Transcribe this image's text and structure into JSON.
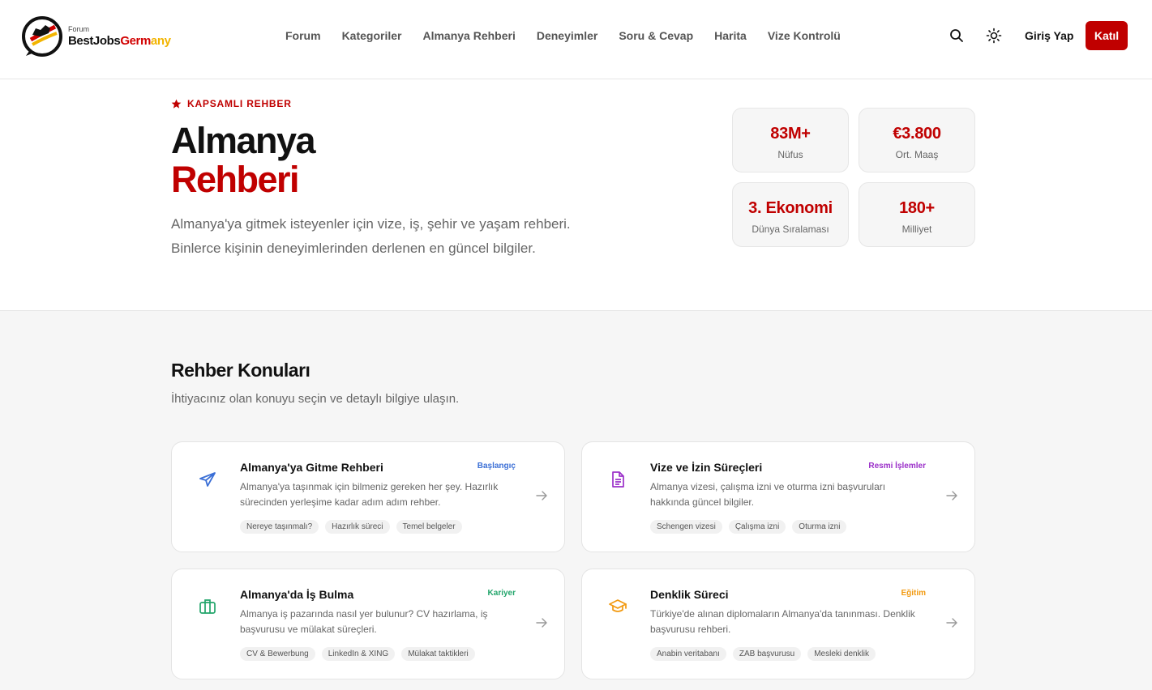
{
  "header": {
    "logo": {
      "small": "Forum",
      "part1": "BestJobs",
      "part2": "Germ",
      "part3": "any"
    },
    "nav": [
      "Forum",
      "Kategoriler",
      "Almanya Rehberi",
      "Deneyimler",
      "Soru & Cevap",
      "Harita",
      "Vize Kontrolü"
    ],
    "login_label": "Giriş Yap",
    "join_label": "Katıl"
  },
  "hero": {
    "eyebrow": "KAPSAMLI REHBER",
    "title_line1": "Almanya",
    "title_line2": "Rehberi",
    "desc_line1": "Almanya'ya gitmek isteyenler için vize, iş, şehir ve yaşam rehberi.",
    "desc_line2": "Binlerce kişinin deneyimlerinden derlenen en güncel bilgiler.",
    "stats": [
      {
        "value": "83M+",
        "label": "Nüfus"
      },
      {
        "value": "€3.800",
        "label": "Ort. Maaş"
      },
      {
        "value": "3. Ekonomi",
        "label": "Dünya Sıralaması"
      },
      {
        "value": "180+",
        "label": "Milliyet"
      }
    ]
  },
  "section": {
    "title": "Rehber Konuları",
    "subtitle": "İhtiyacınız olan konuyu seçin ve detaylı bilgiye ulaşın.",
    "cards": [
      {
        "icon": "plane-icon",
        "title": "Almanya'ya Gitme Rehberi",
        "badge": "Başlangıç",
        "color": "#3b6fd6",
        "desc": "Almanya'ya taşınmak için bilmeniz gereken her şey. Hazırlık sürecinden yerleşime kadar adım adım rehber.",
        "tags": [
          "Nereye taşınmalı?",
          "Hazırlık süreci",
          "Temel belgeler"
        ]
      },
      {
        "icon": "document-icon",
        "title": "Vize ve İzin Süreçleri",
        "badge": "Resmi İşlemler",
        "color": "#9b30c9",
        "desc": "Almanya vizesi, çalışma izni ve oturma izni başvuruları hakkında güncel bilgiler.",
        "tags": [
          "Schengen vizesi",
          "Çalışma izni",
          "Oturma izni"
        ]
      },
      {
        "icon": "briefcase-icon",
        "title": "Almanya'da İş Bulma",
        "badge": "Kariyer",
        "color": "#22a56b",
        "desc": "Almanya iş pazarında nasıl yer bulunur? CV hazırlama, iş başvurusu ve mülakat süreçleri.",
        "tags": [
          "CV & Bewerbung",
          "LinkedIn & XING",
          "Mülakat taktikleri"
        ]
      },
      {
        "icon": "graduation-cap-icon",
        "title": "Denklik Süreci",
        "badge": "Eğitim",
        "color": "#f29a11",
        "desc": "Türkiye'de alınan diplomaların Almanya'da tanınması. Denklik başvurusu rehberi.",
        "tags": [
          "Anabin veritabanı",
          "ZAB başvurusu",
          "Mesleki denklik"
        ]
      }
    ]
  }
}
